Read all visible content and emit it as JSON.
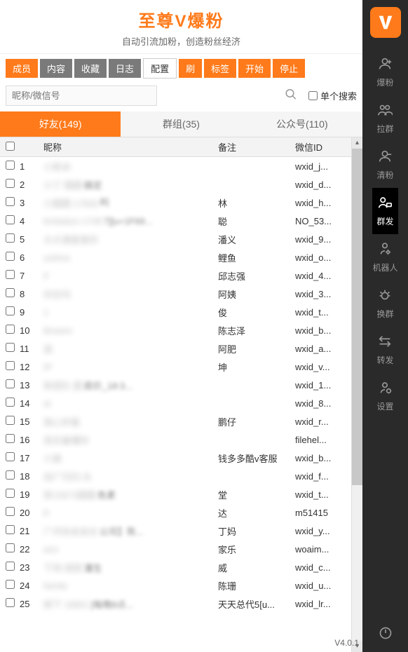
{
  "header": {
    "title": "至尊V爆粉",
    "subtitle": "自动引流加粉，创造粉丝经济"
  },
  "toolbar": {
    "members": "成员",
    "content": "内容",
    "favorite": "收藏",
    "log": "日志",
    "config": "配置",
    "refresh": "刷",
    "tags": "标签",
    "start": "开始",
    "stop": "停止"
  },
  "search": {
    "placeholder": "昵称/微信号",
    "single_search": "单个搜索"
  },
  "tabs": {
    "friends": "好友(149)",
    "groups": "群组(35)",
    "accounts": "公众号(110)"
  },
  "columns": {
    "nick": "昵称",
    "remark": "备注",
    "wxid": "微信ID"
  },
  "rows": [
    {
      "n": "1",
      "nick_blur": "小新米",
      "nick_clear": "",
      "remark": "",
      "wxid": "wxid_j..."
    },
    {
      "n": "2",
      "nick_blur": "小丁 圆圆 ",
      "nick_clear": "搞定",
      "remark": "",
      "wxid": "wxid_d..."
    },
    {
      "n": "3",
      "nick_blur": "小圆圆 17606",
      "nick_clear": "B]",
      "remark": "林",
      "wxid": "wxid_h..."
    },
    {
      "n": "4",
      "nick_blur": "limitation 1708",
      "nick_clear": "7][u+1F69...",
      "remark": "聪",
      "wxid": "NO_53..."
    },
    {
      "n": "5",
      "nick_blur": "大大遇爱爱的",
      "nick_clear": "",
      "remark": "潘义",
      "wxid": "wxid_9..."
    },
    {
      "n": "6",
      "nick_blur": "yukina",
      "nick_clear": "",
      "remark": "鲤鱼",
      "wxid": "wxid_o..."
    },
    {
      "n": "7",
      "nick_blur": "if",
      "nick_clear": "",
      "remark": "邱志强",
      "wxid": "wxid_4..."
    },
    {
      "n": "8",
      "nick_blur": "你在吗",
      "nick_clear": "",
      "remark": "阿姨",
      "wxid": "wxid_3..."
    },
    {
      "n": "9",
      "nick_blur": "1",
      "nick_clear": "",
      "remark": "俊",
      "wxid": "wxid_t..."
    },
    {
      "n": "10",
      "nick_blur": "Brasen",
      "nick_clear": "",
      "remark": "陈志泽",
      "wxid": "wxid_b..."
    },
    {
      "n": "11",
      "nick_blur": "我",
      "nick_clear": "",
      "remark": "阿肥",
      "wxid": "wxid_a..."
    },
    {
      "n": "12",
      "nick_blur": "IP",
      "nick_clear": "",
      "remark": "坤",
      "wxid": "wxid_v..."
    },
    {
      "n": "13",
      "nick_blur": "新团队 圆",
      "nick_clear": "底价_18:3...",
      "remark": "",
      "wxid": "wxid_1..."
    },
    {
      "n": "14",
      "nick_blur": "al",
      "nick_clear": "",
      "remark": "",
      "wxid": "wxid_8..."
    },
    {
      "n": "15",
      "nick_blur": "我心听着",
      "nick_clear": "",
      "remark": "鹏仔",
      "wxid": "wxid_r..."
    },
    {
      "n": "16",
      "nick_blur": "其实最懂你",
      "nick_clear": "",
      "remark": "",
      "wxid": "filehel..."
    },
    {
      "n": "17",
      "nick_blur": "小兽",
      "nick_clear": "",
      "remark": "钱多多酷v客服",
      "wxid": "wxid_b..."
    },
    {
      "n": "18",
      "nick_blur": "加广归归 水",
      "nick_clear": "",
      "remark": "",
      "wxid": "wxid_f..."
    },
    {
      "n": "19",
      "nick_blur": "家15873圆圆",
      "nick_clear": "色素",
      "remark": "堂",
      "wxid": "wxid_t..."
    },
    {
      "n": "20",
      "nick_blur": "8",
      "nick_clear": "",
      "remark": "达",
      "wxid": "m51415"
    },
    {
      "n": "21",
      "nick_blur": "广州协会会长",
      "nick_clear": "公司】陈...",
      "remark": "丁妈",
      "wxid": "wxid_y..."
    },
    {
      "n": "22",
      "nick_blur": "ans",
      "nick_clear": "",
      "remark": "家乐",
      "wxid": "woaim..."
    },
    {
      "n": "23",
      "nick_blur": "下场 团团 ",
      "nick_clear": "潘生",
      "remark": "威",
      "wxid": "wxid_c..."
    },
    {
      "n": "24",
      "nick_blur": "family",
      "nick_clear": "",
      "remark": "陈珊",
      "wxid": "wxid_u..."
    },
    {
      "n": "25",
      "nick_blur": "柳下 18801",
      "nick_clear": "]每晚8点...",
      "remark": "天天总代5[u...",
      "wxid": "wxid_lr..."
    }
  ],
  "sidebar": {
    "items": [
      {
        "label": "爆粉"
      },
      {
        "label": "拉群"
      },
      {
        "label": "清粉"
      },
      {
        "label": "群发"
      },
      {
        "label": "机器人"
      },
      {
        "label": "换群"
      },
      {
        "label": "转发"
      },
      {
        "label": "设置"
      }
    ]
  },
  "version": "V4.0.1"
}
